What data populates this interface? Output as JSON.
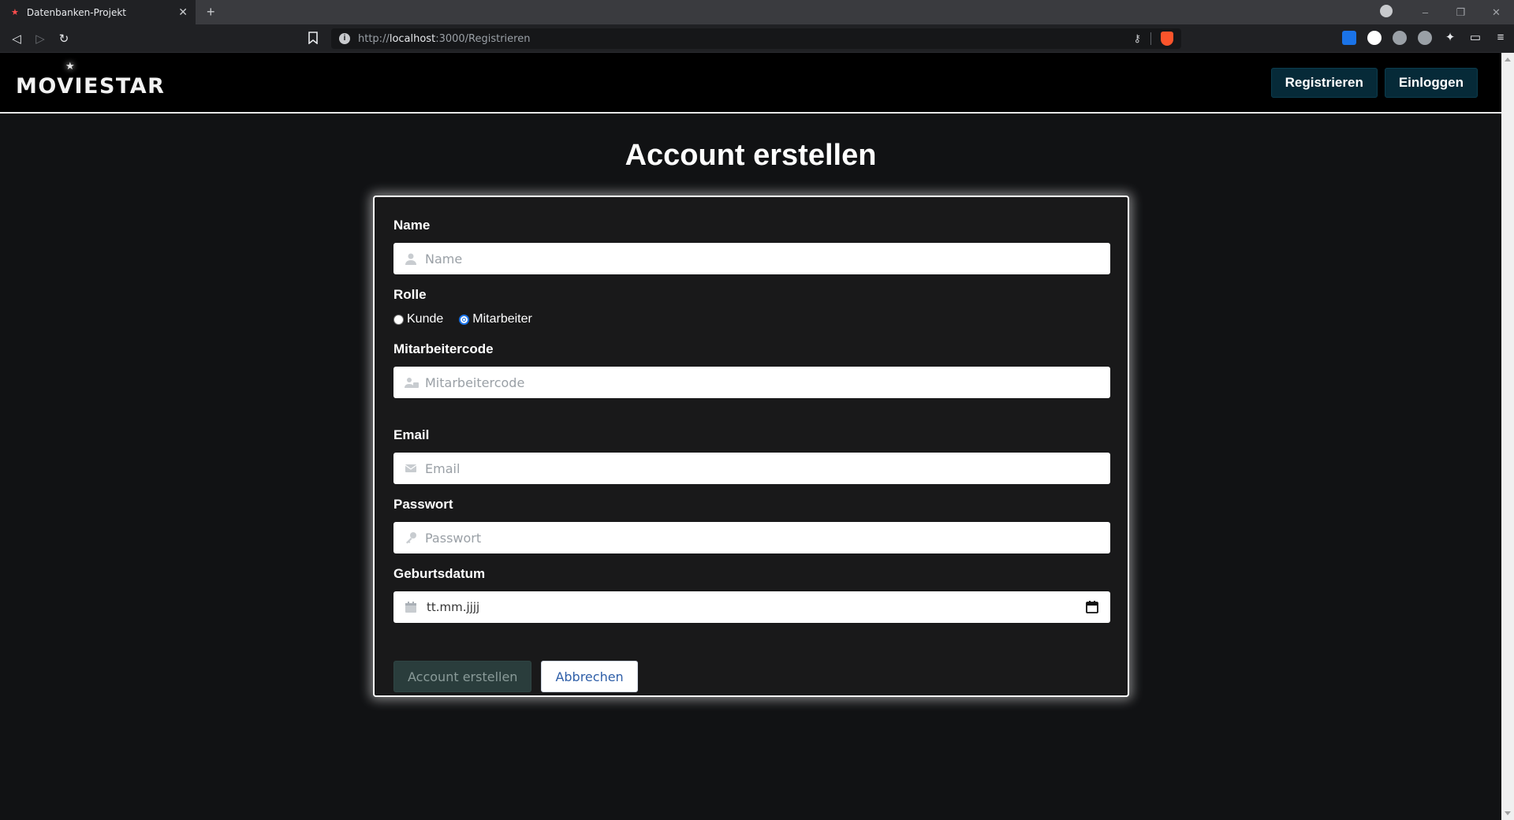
{
  "browser": {
    "tab_title": "Datenbanken-Projekt",
    "tab_close": "✕",
    "new_tab": "+",
    "url_host": "localhost",
    "url_prefix": "http://",
    "url_path": ":3000/Registrieren",
    "window_minimize": "–",
    "window_restore": "❐",
    "window_close": "✕"
  },
  "header": {
    "logo_text": "MOVIESTAR",
    "register_label": "Registrieren",
    "login_label": "Einloggen"
  },
  "page": {
    "title": "Account erstellen"
  },
  "form": {
    "name_label": "Name",
    "name_placeholder": "Name",
    "role_label": "Rolle",
    "role_options": [
      "Kunde",
      "Mitarbeiter"
    ],
    "role_selected": "Mitarbeiter",
    "code_label": "Mitarbeitercode",
    "code_placeholder": "Mitarbeitercode",
    "email_label": "Email",
    "email_placeholder": "Email",
    "password_label": "Passwort",
    "password_placeholder": "Passwort",
    "birthdate_label": "Geburtsdatum",
    "birthdate_value": "tt.mm.jjjj",
    "submit_label": "Account erstellen",
    "cancel_label": "Abbrechen"
  },
  "colors": {
    "header_button_bg": "#062a38",
    "submit_bg": "#2a3d3c",
    "page_bg": "#111214",
    "card_bg": "#19191a"
  }
}
